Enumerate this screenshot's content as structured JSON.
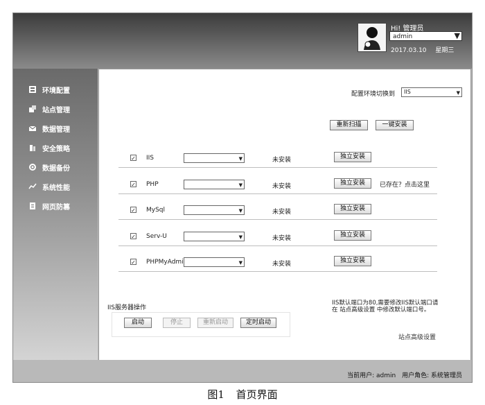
{
  "header": {
    "greeting": "Hi! 管理员",
    "user_select": "admin",
    "date": "2017.03.10",
    "weekday": "星期三"
  },
  "sidebar": {
    "items": [
      {
        "label": "环境配置",
        "icon": "server-icon"
      },
      {
        "label": "站点管理",
        "icon": "site-icon"
      },
      {
        "label": "数据管理",
        "icon": "mail-icon"
      },
      {
        "label": "安全策略",
        "icon": "shield-icon"
      },
      {
        "label": "数据备份",
        "icon": "gear-icon"
      },
      {
        "label": "系统性能",
        "icon": "performance-icon"
      },
      {
        "label": "网页防篡",
        "icon": "document-icon"
      }
    ]
  },
  "main": {
    "env_switch_label": "配置环境切换到",
    "env_switch_value": "IIS",
    "rescan_button": "重新扫描",
    "one_click_install_button": "一键安装",
    "components": [
      {
        "name": "IIS",
        "checked": true,
        "status": "未安装",
        "install": "独立安装",
        "extra": ""
      },
      {
        "name": "PHP",
        "checked": true,
        "status": "未安装",
        "install": "独立安装",
        "extra": "已存在？点击这里"
      },
      {
        "name": "MySql",
        "checked": true,
        "status": "未安装",
        "install": "独立安装",
        "extra": ""
      },
      {
        "name": "Serv-U",
        "checked": true,
        "status": "未安装",
        "install": "独立安装",
        "extra": ""
      },
      {
        "name": "PHPMyAdmin",
        "checked": true,
        "status": "未安装",
        "install": "独立安装",
        "extra": ""
      }
    ],
    "iis_ops": {
      "title": "IIS服务器操作",
      "start": "启动",
      "stop": "停止",
      "restart": "重新启动",
      "scheduled_start": "定时启动"
    },
    "note_line1": "IIS默认端口为80,需要修改IIS默认端口请",
    "note_line2": "在 站点高级设置 中修改默认端口号。",
    "advanced_link": "站点高级设置"
  },
  "status": {
    "current_user": "当前用户: admin",
    "user_role": "用户角色: 系统管理员"
  },
  "caption": {
    "figure": "图1",
    "title": "首页界面"
  }
}
